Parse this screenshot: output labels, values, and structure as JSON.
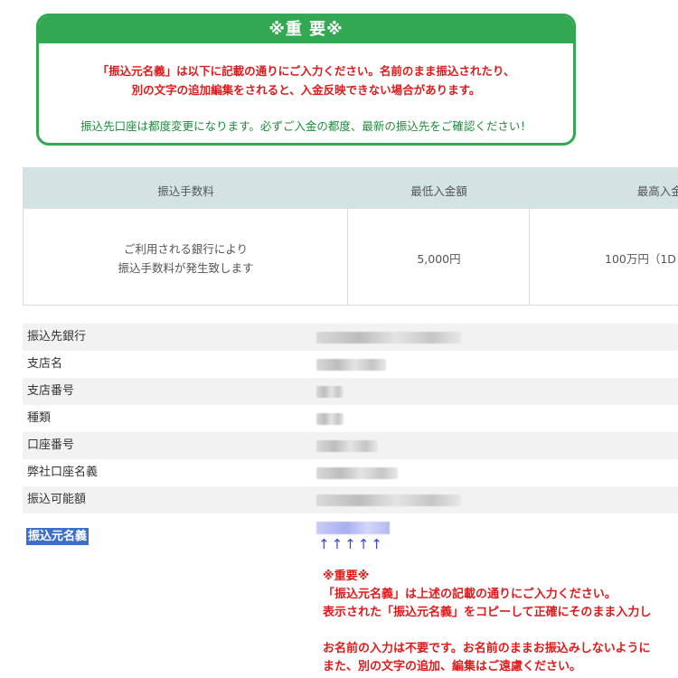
{
  "notice": {
    "title": "※重 要※",
    "line1": "「振込元名義」は以下に記載の通りにご入力ください。名前のまま振込されたり、",
    "line2": "別の文字の追加編集をされると、入金反映できない場合があります。",
    "line3": "振込先口座は都度変更になります。必ずご入金の都度、最新の振込先をご確認ください！"
  },
  "fees": {
    "headers": [
      "振込手数料",
      "最低入金額",
      "最高入金額"
    ],
    "fee_line1": "ご利用される銀行により",
    "fee_line2": "振込手数料が発生致します",
    "min": "5,000円",
    "max": "100万円（1D"
  },
  "details": {
    "rows": [
      {
        "label": "振込先銀行"
      },
      {
        "label": "支店名"
      },
      {
        "label": "支店番号"
      },
      {
        "label": "種類"
      },
      {
        "label": "口座番号"
      },
      {
        "label": "弊社口座名義"
      },
      {
        "label": "振込可能額"
      }
    ],
    "sender_label": "振込元名義",
    "arrows": "↑↑↑↑↑"
  },
  "warning": {
    "title": "※重要※",
    "line1": "「振込元名義」は上述の記載の通りにご入力ください。",
    "line2": "表示された「振込元名義」をコピーして正確にそのまま入力し",
    "line3": "お名前の入力は不要です。お名前のままお振込みしないように",
    "line4": "また、別の文字の追加、編集はご遠慮ください。"
  }
}
